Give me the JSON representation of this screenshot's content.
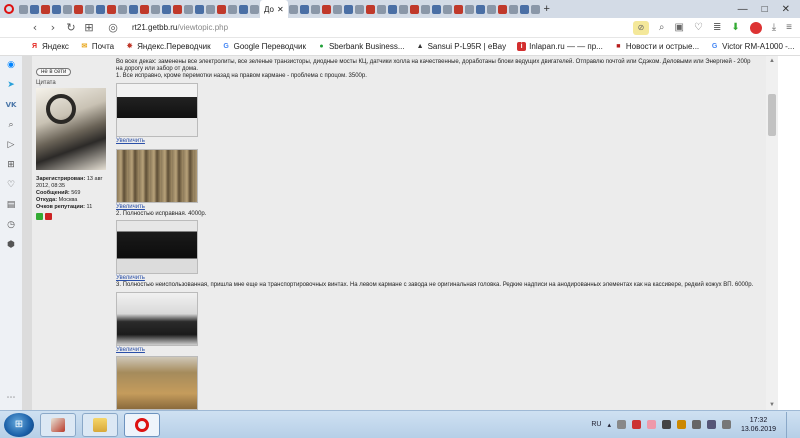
{
  "browser": {
    "active_tab_title": "До",
    "new_tab_label": "+",
    "url_host": "rt21.getbb.ru",
    "url_path": "/viewtopic.php",
    "window_controls": [
      "—",
      "□",
      "✕"
    ]
  },
  "bookmarks": [
    {
      "label": "Яндекс",
      "icon": "yandex-icon",
      "color": "#e52620",
      "glyph": "Я"
    },
    {
      "label": "Почта",
      "icon": "mail-icon",
      "color": "#e8a820",
      "glyph": "✉"
    },
    {
      "label": "Яндекс.Переводчик",
      "icon": "translate-icon",
      "color": "#c0392b",
      "glyph": "✸"
    },
    {
      "label": "Google Переводчик",
      "icon": "google-icon",
      "color": "#4285f4",
      "glyph": "G"
    },
    {
      "label": "Sberbank Business...",
      "icon": "sberbank-icon",
      "color": "#21a038",
      "glyph": "●"
    },
    {
      "label": "Sansui P-L95R | eBay",
      "icon": "ebay-icon",
      "color": "#333333",
      "glyph": "▲"
    },
    {
      "label": "Inlapan.ru — — пр...",
      "icon": "inlapan-icon",
      "color": "#d32f2f",
      "glyph": "i"
    },
    {
      "label": "Новости и острые...",
      "icon": "news-icon",
      "color": "#b71c1c",
      "glyph": "■"
    },
    {
      "label": "Victor RM-A1000 -...",
      "icon": "google-icon",
      "color": "#4285f4",
      "glyph": "G"
    }
  ],
  "bookmarks_more": "»",
  "profile": {
    "online_badge": "не в сети",
    "quote_link": "Цитата",
    "registered_label": "Зарегистрирован:",
    "registered_value": "13 авг 2012, 08:35",
    "messages_label": "Сообщений:",
    "messages_value": "569",
    "from_label": "Откуда:",
    "from_value": "Москва",
    "reputation_label": "Очков репутации:",
    "reputation_value": "11"
  },
  "post": {
    "intro": "Во всех деках: заменены все электролиты, все зеленые транзисторы, диодные мосты КЦ, датчики холла на качественные, доработаны блоки ведущих двигателей. Отправлю почтой или Сдэком. Деловыми или Энергией - 200р на дорогу или забор от дома.",
    "item1": "1. Все исправно, кроме перемотки назад на правом кармане - проблема с процом. 3500р.",
    "item2": "2. Полностью исправная. 4000р.",
    "item3": "3. Полностью неиспользованная, пришла мне еще на транспортировочных винтах. На левом кармане с завода не оригинальная головка. Редкие надписи на анодированных элементах как на кассивере, редкий кожух ВП. 6000р.",
    "enlarge_label": "Увеличить"
  },
  "taskbar": {
    "language": "RU",
    "time": "17:32",
    "date": "13.06.2019"
  },
  "colors": {
    "link": "#2a4fa8",
    "opera_red": "#dd1111",
    "tabstrip": "#d3dbe6"
  }
}
